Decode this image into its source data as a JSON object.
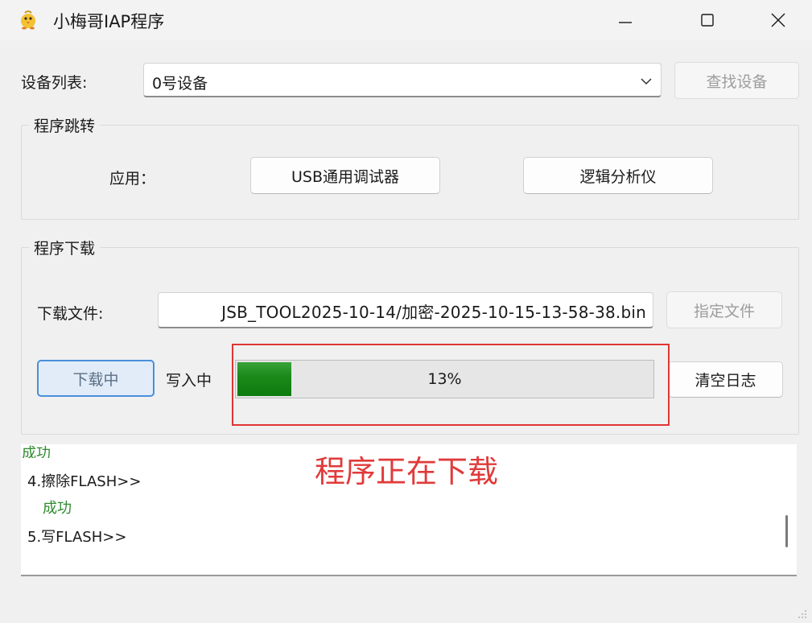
{
  "window": {
    "title": "小梅哥IAP程序",
    "icon": "chick-app-icon",
    "controls": [
      "minimize-icon",
      "maximize-icon",
      "close-icon"
    ]
  },
  "device": {
    "label": "设备列表:",
    "selected": "0号设备",
    "find_button": "查找设备"
  },
  "jump_group": {
    "title": "程序跳转",
    "app_label": "应用：",
    "buttons": [
      "USB通用调试器",
      "逻辑分析仪"
    ]
  },
  "download_group": {
    "title": "程序下载",
    "file_label": "下载文件:",
    "file_path": "JSB_TOOL2025-10-14/加密-2025-10-15-13-58-38.bin",
    "choose_button": "指定文件",
    "download_button": "下载中",
    "status_text": "写入中",
    "progress_percent": 13,
    "progress_label": "13%",
    "clear_log_button": "清空日志"
  },
  "log": {
    "lines": [
      {
        "text": "成功",
        "status": "ok"
      },
      {
        "text": "4.擦除FLASH>>",
        "status": "step"
      },
      {
        "text": "成功",
        "status": "ok"
      },
      {
        "text": "5.写FLASH>>",
        "status": "step"
      }
    ]
  },
  "annotation": {
    "text": "程序正在下载",
    "color": "#e03a3a"
  },
  "colors": {
    "progress_fill": "#1b8a1b",
    "success_text": "#2e8b2e",
    "highlight_border": "#e03535"
  }
}
